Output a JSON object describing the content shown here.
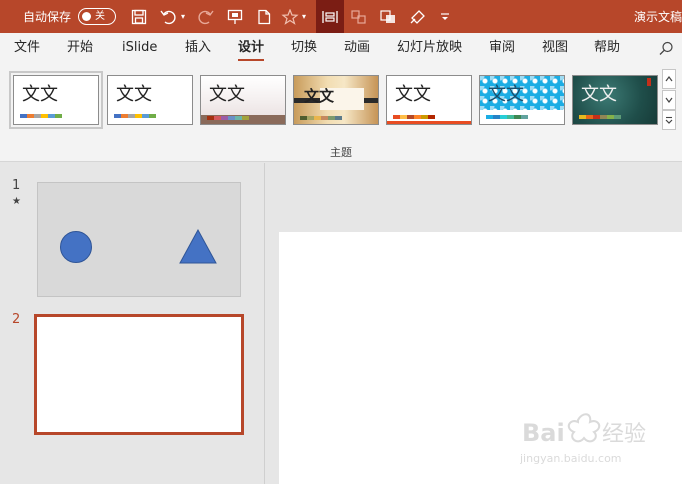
{
  "titlebar": {
    "autosave_label": "自动保存",
    "autosave_state": "关",
    "doc_title": "演示文稿",
    "bg_color": "#b7472a",
    "quick_access": [
      "save-icon",
      "undo-icon",
      "redo-icon",
      "present-icon",
      "new-file-icon",
      "star-icon",
      "align-icon",
      "shapes-icon",
      "arrange-icon",
      "format-painter-icon",
      "customize-icon"
    ]
  },
  "tabs": [
    "文件",
    "开始",
    "iSlide",
    "插入",
    "设计",
    "切换",
    "动画",
    "幻灯片放映",
    "审阅",
    "视图",
    "帮助"
  ],
  "active_tab": "设计",
  "ribbon": {
    "group_label": "主题",
    "themes": [
      {
        "text": "文文",
        "swatches": [
          "#4472c4",
          "#ed7d31",
          "#a5a5a5",
          "#ffc000",
          "#5b9bd5",
          "#70ad47"
        ]
      },
      {
        "text": "文文",
        "swatches": [
          "#4472c4",
          "#ed7d31",
          "#a5a5a5",
          "#ffc000",
          "#5b9bd5",
          "#70ad47"
        ]
      },
      {
        "text": "文文",
        "swatches": [
          "#a5300f",
          "#d5585c",
          "#9c5ca7",
          "#6a8fc6",
          "#6bb5a8",
          "#a3a23c"
        ]
      },
      {
        "text": "文文",
        "swatches": [
          "#4f5d2f",
          "#a5a564",
          "#e8b54d",
          "#c5895e",
          "#7e9a6c",
          "#5d7b8a"
        ]
      },
      {
        "text": "文文",
        "swatches": [
          "#e84c22",
          "#ffbd47",
          "#b64926",
          "#ff8427",
          "#cc9900",
          "#b22600"
        ]
      },
      {
        "text": "文文",
        "swatches": [
          "#1cade4",
          "#2683c6",
          "#27ced7",
          "#42ba97",
          "#3e8853",
          "#62a39f"
        ]
      },
      {
        "text": "文文",
        "swatches": [
          "#e6b91e",
          "#e76618",
          "#c42f1a",
          "#918655",
          "#84b14a",
          "#5d9b77"
        ]
      }
    ]
  },
  "slides": [
    {
      "number": "1",
      "marker": "★"
    },
    {
      "number": "2",
      "marker": ""
    }
  ],
  "watermark": {
    "brand": "Bai经验",
    "url": "jingyan.baidu.com"
  }
}
